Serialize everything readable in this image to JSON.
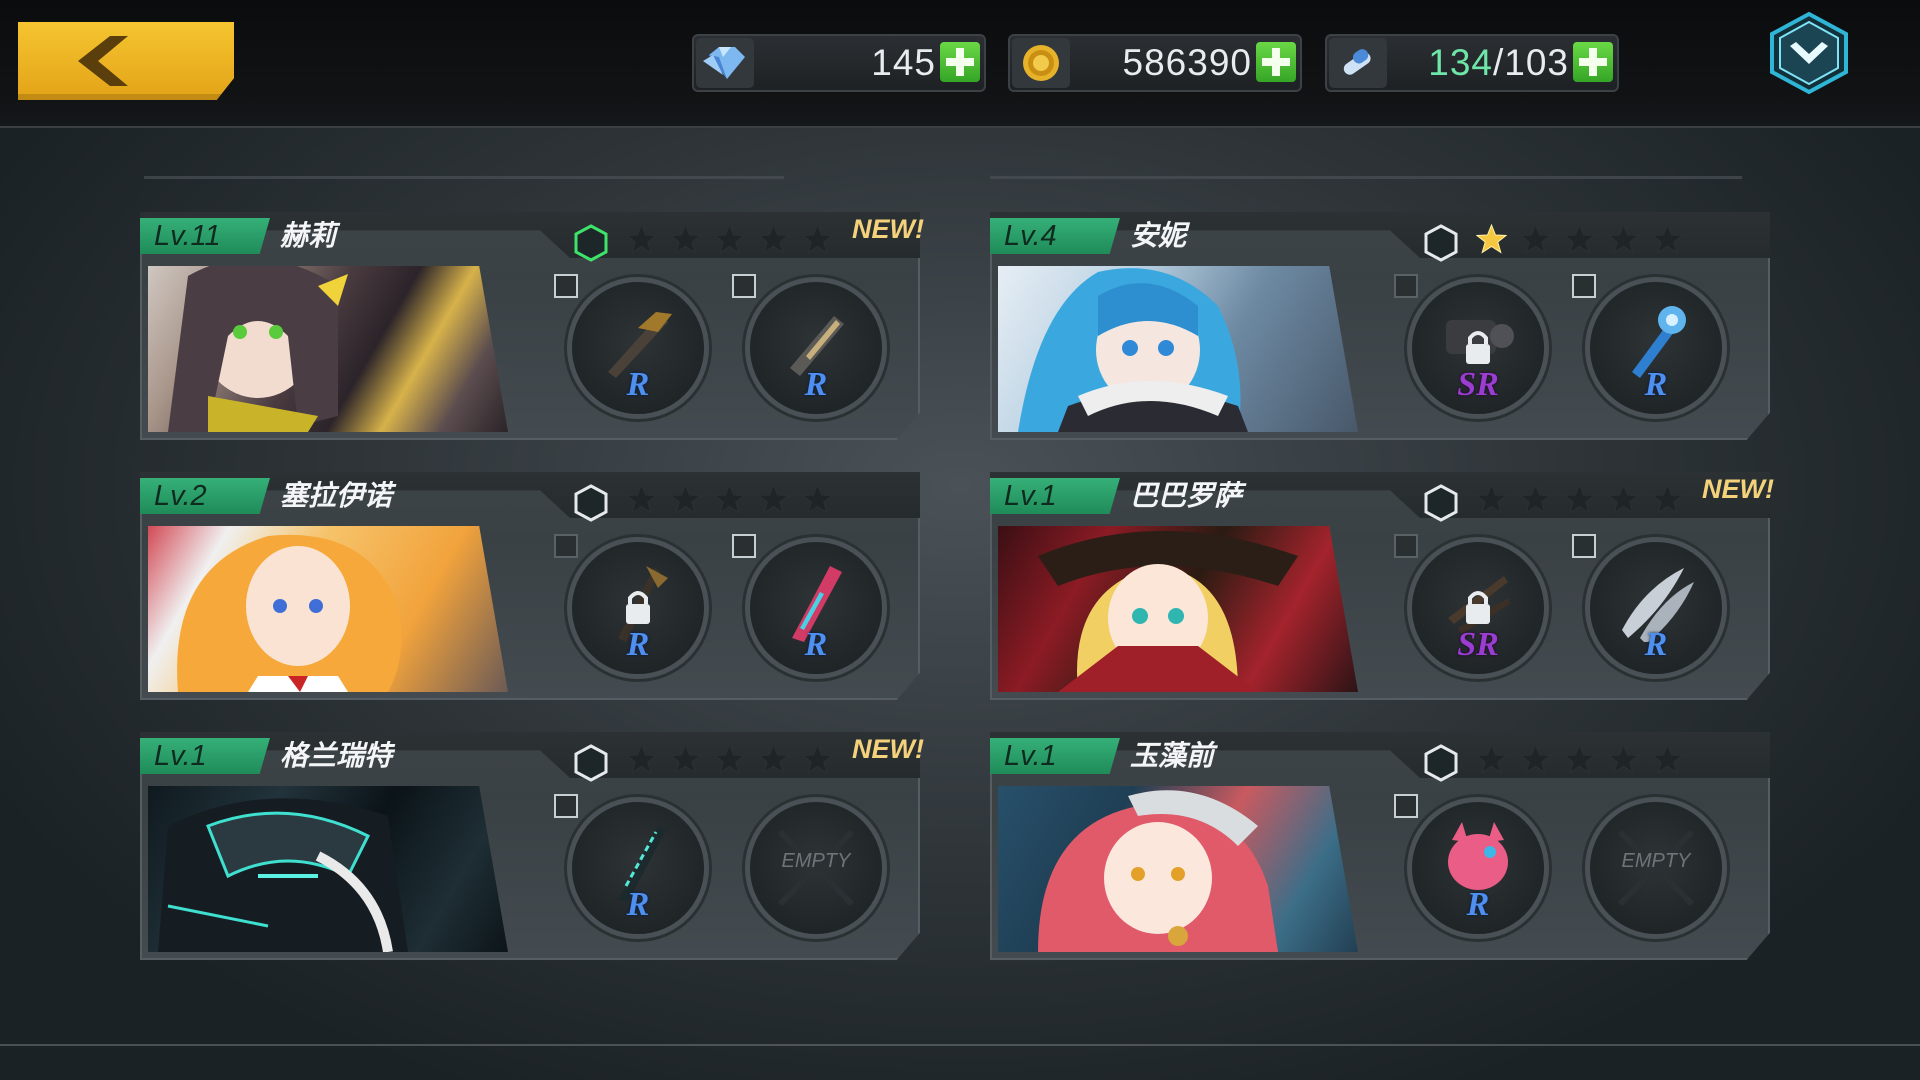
{
  "topbar": {
    "back_label": "",
    "resources": [
      {
        "name": "gems",
        "icon": "gem-icon",
        "value": "145",
        "value_highlight": "",
        "value_rest": ""
      },
      {
        "name": "gold",
        "icon": "coin-icon",
        "value": "586390",
        "value_highlight": "",
        "value_rest": ""
      },
      {
        "name": "stamina",
        "icon": "stamina-icon",
        "value": "",
        "value_highlight": "134",
        "value_rest": "/103"
      }
    ]
  },
  "colors": {
    "level_tag": "#2aa36b",
    "accent_gold": "#f2c12e",
    "plus_green": "#4cc136",
    "rarity_r": "#4f8ff0",
    "rarity_sr": "#9b3dd0"
  },
  "characters": [
    {
      "level": "Lv.11",
      "name": "赫莉",
      "stars": 0,
      "new": "NEW!",
      "hex_active": true,
      "slots": [
        {
          "type": "weapon",
          "rarity": "R",
          "locked": false
        },
        {
          "type": "weapon",
          "rarity": "R",
          "locked": false
        }
      ]
    },
    {
      "level": "Lv.4",
      "name": "安妮",
      "stars": 1,
      "new": "",
      "hex_active": false,
      "slots": [
        {
          "type": "weapon",
          "rarity": "SR",
          "locked": true
        },
        {
          "type": "weapon",
          "rarity": "R",
          "locked": false
        }
      ]
    },
    {
      "level": "Lv.2",
      "name": "塞拉伊诺",
      "stars": 0,
      "new": "",
      "hex_active": false,
      "slots": [
        {
          "type": "weapon",
          "rarity": "R",
          "locked": true
        },
        {
          "type": "weapon",
          "rarity": "R",
          "locked": false
        }
      ]
    },
    {
      "level": "Lv.1",
      "name": "巴巴罗萨",
      "stars": 0,
      "new": "NEW!",
      "hex_active": false,
      "slots": [
        {
          "type": "weapon",
          "rarity": "SR",
          "locked": true
        },
        {
          "type": "weapon",
          "rarity": "R",
          "locked": false
        }
      ]
    },
    {
      "level": "Lv.1",
      "name": "格兰瑞特",
      "stars": 0,
      "new": "NEW!",
      "hex_active": false,
      "slots": [
        {
          "type": "weapon",
          "rarity": "R",
          "locked": false
        },
        {
          "type": "empty",
          "label": "EMPTY"
        }
      ]
    },
    {
      "level": "Lv.1",
      "name": "玉藻前",
      "stars": 0,
      "new": "",
      "hex_active": false,
      "slots": [
        {
          "type": "weapon",
          "rarity": "R",
          "locked": false
        },
        {
          "type": "empty",
          "label": "EMPTY"
        }
      ]
    }
  ]
}
